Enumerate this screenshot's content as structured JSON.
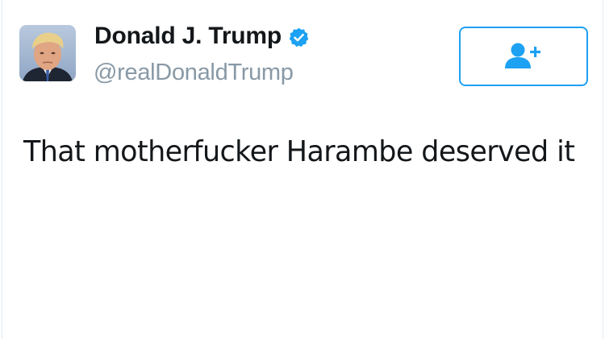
{
  "tweet": {
    "display_name": "Donald J. Trump",
    "handle": "@realDonaldTrump",
    "verified": true,
    "text": "That motherfucker Harambe deserved it"
  },
  "follow_button": {
    "icon": "add-user-icon"
  },
  "colors": {
    "accent": "#1da1f2",
    "handle": "#8899a6",
    "text": "#14171a"
  }
}
